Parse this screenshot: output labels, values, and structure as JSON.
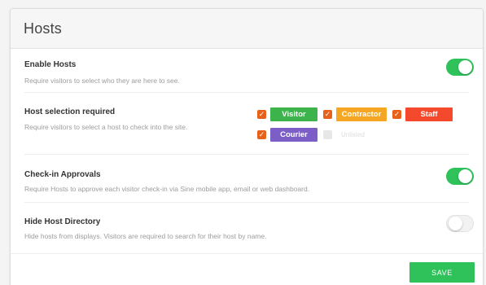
{
  "card": {
    "title": "Hosts"
  },
  "enable_hosts": {
    "title": "Enable Hosts",
    "description": "Require visitors to select who they are here to see.",
    "enabled": true
  },
  "host_selection": {
    "title": "Host selection required",
    "description": "Require visitors to select a host to check into the site.",
    "types": [
      {
        "label": "Visitor",
        "checked": true,
        "color": "#3cb44b"
      },
      {
        "label": "Contractor",
        "checked": true,
        "color": "#f5a623"
      },
      {
        "label": "Staff",
        "checked": true,
        "color": "#f5492d"
      },
      {
        "label": "Courier",
        "checked": true,
        "color": "#7b5ec6"
      },
      {
        "label": "Unlisted",
        "checked": false,
        "color": "#d8d8d8"
      }
    ]
  },
  "checkin_approvals": {
    "title": "Check-in Approvals",
    "description": "Require Hosts to approve each visitor check-in via Sine mobile app, email or web dashboard.",
    "enabled": true
  },
  "hide_directory": {
    "title": "Hide Host Directory",
    "description": "Hide hosts from displays. Visitors are required to search for their host by name.",
    "enabled": false
  },
  "footer": {
    "save_label": "SAVE"
  },
  "colors": {
    "accent": "#2fc25b",
    "checkbox": "#e8611a"
  }
}
